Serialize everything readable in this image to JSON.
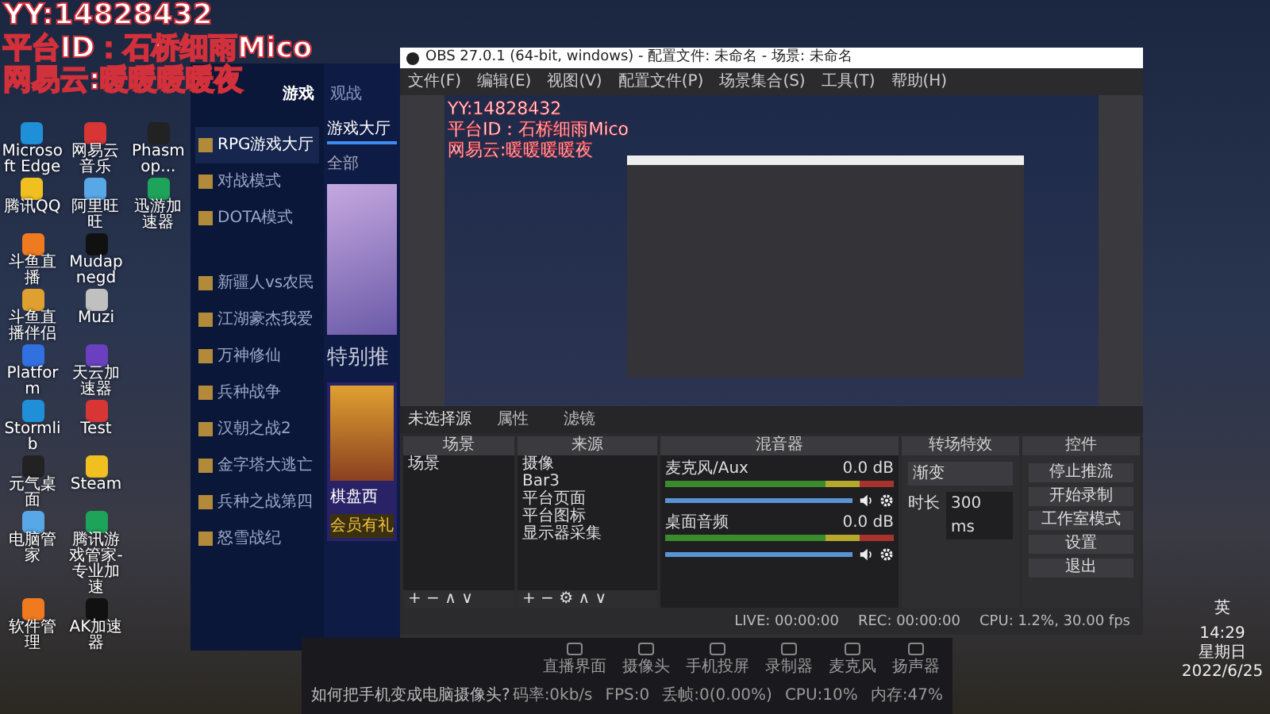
{
  "overlay": [
    "YY:14828432",
    "平台ID：石桥细雨Mico",
    "网易云:暖暖暖暖夜"
  ],
  "desktop_icons": [
    [
      "Microsoft Edge",
      "网易云音乐",
      "Phasmop..."
    ],
    [
      "腾讯QQ",
      "阿里旺旺",
      "迅游加速器"
    ],
    [
      "斗鱼直播",
      "Mudapnegd"
    ],
    [
      "斗鱼直播伴侣",
      "Muzi"
    ],
    [
      "Platform",
      "天云加速器"
    ],
    [
      "Stormlib",
      "Test"
    ],
    [
      "元气桌面",
      "Steam"
    ],
    [
      "电脑管家",
      "腾讯游戏管家-专业加速"
    ],
    [
      "软件管理",
      "AK加速器"
    ]
  ],
  "launcher": {
    "nav": [
      {
        "label": "游戏",
        "selected": true
      },
      {
        "label": "观战",
        "selected": false
      }
    ],
    "sidebar": [
      {
        "label": "RPG游戏大厅",
        "selected": true
      },
      {
        "label": "对战模式",
        "selected": false
      },
      {
        "label": "DOTA模式",
        "selected": false
      },
      {
        "label": "新疆人vs农民",
        "selected": false
      },
      {
        "label": "江湖豪杰我爱",
        "selected": false
      },
      {
        "label": "万神修仙",
        "selected": false
      },
      {
        "label": "兵种战争",
        "selected": false
      },
      {
        "label": "汉朝之战2",
        "selected": false
      },
      {
        "label": "金字塔大逃亡",
        "selected": false
      },
      {
        "label": "兵种之战第四",
        "selected": false
      },
      {
        "label": "怒雪战纪",
        "selected": false
      }
    ],
    "tab": "游戏大厅",
    "filter": "全部",
    "section_title": "特别推",
    "card": {
      "title": "棋盘西",
      "badge": "会员有礼"
    }
  },
  "obs": {
    "title": "OBS 27.0.1 (64-bit, windows) - 配置文件: 未命名 - 场景: 未命名",
    "menu": [
      "文件(F)",
      "编辑(E)",
      "视图(V)",
      "配置文件(P)",
      "场景集合(S)",
      "工具(T)",
      "帮助(H)"
    ],
    "preview": {
      "overlay": [
        "YY:14828432",
        "平台ID：石桥细雨Mico",
        "网易云:暖暖暖暖夜"
      ]
    },
    "source_toolbar": {
      "label": "未选择源",
      "buttons": [
        "属性",
        "滤镜"
      ]
    },
    "scenes": {
      "title": "场景",
      "items": [
        "场景"
      ],
      "controls": "+ − ∧ ∨"
    },
    "sources": {
      "title": "来源",
      "items": [
        "摄像",
        "Bar3",
        "平台页面",
        "平台图标",
        "显示器采集"
      ],
      "controls": "+ − ⚙ ∧ ∨"
    },
    "mixer": {
      "title": "混音器",
      "channels": [
        {
          "name": "麦克风/Aux",
          "reading": "0.0 dB",
          "level": 1
        },
        {
          "name": "桌面音频",
          "reading": "0.0 dB",
          "level": 1
        }
      ]
    },
    "transitions": {
      "title": "转场特效",
      "type": "渐变",
      "duration_label": "时长",
      "duration": "300 ms"
    },
    "controls": {
      "title": "控件",
      "buttons": [
        "停止推流",
        "开始录制",
        "工作室模式",
        "设置",
        "退出"
      ]
    },
    "status_bar": [
      "LIVE: 00:00:00",
      "REC: 00:00:00",
      "CPU: 1.2%, 30.00 fps"
    ]
  },
  "stream_bar": {
    "tools": [
      "直播界面",
      "摄像头",
      "手机投屏",
      "录制器",
      "麦克风",
      "扬声器"
    ],
    "tip": "如何把手机变成电脑摄像头?",
    "stats": [
      "码率:0kb/s",
      "FPS:0",
      "丢帧:0(0.00%)",
      "CPU:10%",
      "内存:47%"
    ]
  },
  "tray": {
    "ime": "英",
    "time": "14:29",
    "weekday": "星期日",
    "date": "2022/6/25"
  }
}
